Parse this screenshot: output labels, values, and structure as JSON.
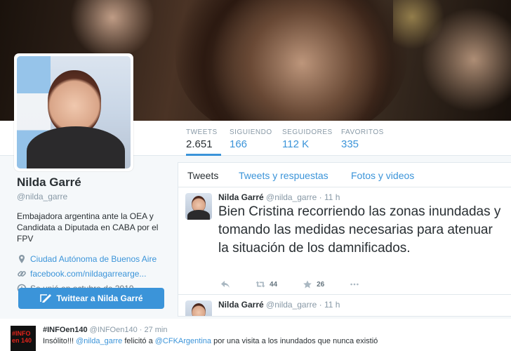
{
  "profile": {
    "name": "Nilda Garré",
    "handle": "@nilda_garre",
    "bio": "Embajadora argentina ante la OEA y Candidata a Diputada en CABA por el FPV",
    "location": "Ciudad Autónoma de Buenos Aire",
    "website": "facebook.com/nildagarrearge...",
    "joined": "Se unió en octubre de 2010",
    "tweet_button": "Twittear a Nilda Garré"
  },
  "stats": [
    {
      "label": "TWEETS",
      "value": "2.651"
    },
    {
      "label": "SIGUIENDO",
      "value": "166"
    },
    {
      "label": "SEGUIDORES",
      "value": "112 K"
    },
    {
      "label": "FAVORITOS",
      "value": "335"
    }
  ],
  "tabs": [
    "Tweets",
    "Tweets y respuestas",
    "Fotos y videos"
  ],
  "tweets": [
    {
      "name": "Nilda Garré",
      "handle": "@nilda_garre",
      "time": "· 11 h",
      "text": "Bien Cristina recorriendo las zonas inundadas y tomando las medidas necesarias para atenuar la situación de los damnificados.",
      "retweets": "44",
      "favorites": "26"
    },
    {
      "name": "Nilda Garré",
      "handle": "@nilda_garre",
      "time": "· 11 h"
    }
  ],
  "bottom": {
    "avatar_line1": "#INFO",
    "avatar_line2": "en 140",
    "name": "#INFOen140",
    "handle": "@INFOen140",
    "time": "· 27 min",
    "text_a": "Insólito!!! ",
    "mention1": "@nilda_garre",
    "text_b": " felicitó a ",
    "mention2": "@CFKArgentina",
    "text_c": " por una visita a los inundados que nunca existió"
  },
  "colors": {
    "accent": "#3b94d9",
    "text": "#292f33",
    "muted": "#8899a6",
    "border": "#e1e8ed"
  }
}
